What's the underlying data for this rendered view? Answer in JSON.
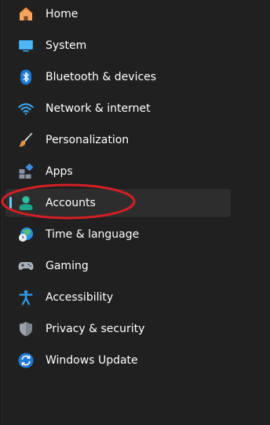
{
  "nav": {
    "items": [
      {
        "label": "Home",
        "icon": "home-icon"
      },
      {
        "label": "System",
        "icon": "system-icon"
      },
      {
        "label": "Bluetooth & devices",
        "icon": "bluetooth-icon"
      },
      {
        "label": "Network & internet",
        "icon": "wifi-icon"
      },
      {
        "label": "Personalization",
        "icon": "brush-icon"
      },
      {
        "label": "Apps",
        "icon": "apps-icon"
      },
      {
        "label": "Accounts",
        "icon": "account-icon",
        "selected": true
      },
      {
        "label": "Time & language",
        "icon": "globe-clock-icon"
      },
      {
        "label": "Gaming",
        "icon": "gamepad-icon"
      },
      {
        "label": "Accessibility",
        "icon": "accessibility-icon"
      },
      {
        "label": "Privacy & security",
        "icon": "shield-icon"
      },
      {
        "label": "Windows Update",
        "icon": "update-icon"
      }
    ]
  },
  "colors": {
    "background": "#202020",
    "selected_background": "#2d2d2d",
    "accent": "#60cdff",
    "annotation": "#d41f26"
  }
}
